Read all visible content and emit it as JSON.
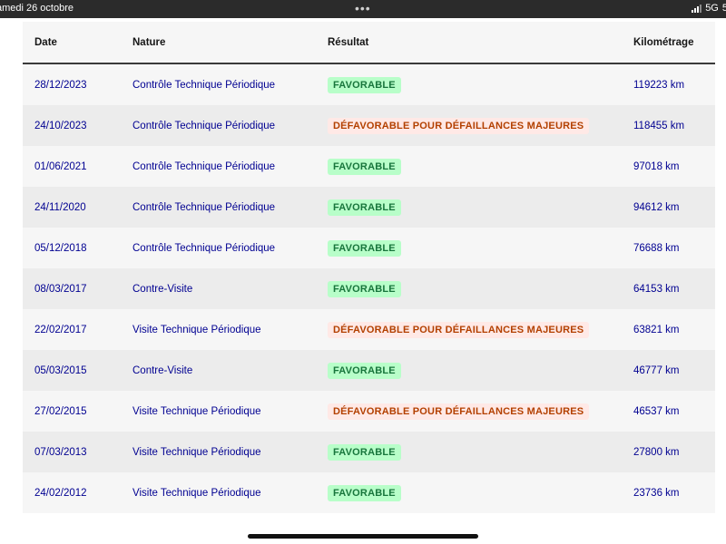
{
  "status_bar": {
    "date": "amedi 26 octobre",
    "dots": "•••",
    "network": "5G",
    "battery_fragment": "5"
  },
  "table": {
    "headers": {
      "date": "Date",
      "nature": "Nature",
      "result": "Résultat",
      "mileage": "Kilométrage"
    },
    "rows": [
      {
        "date": "28/12/2023",
        "nature": "Contrôle Technique Périodique",
        "result": "FAVORABLE",
        "status": "favorable",
        "mileage": "119223 km"
      },
      {
        "date": "24/10/2023",
        "nature": "Contrôle Technique Périodique",
        "result": "DÉFAVORABLE POUR DÉFAILLANCES MAJEURES",
        "status": "defavorable",
        "mileage": "118455 km"
      },
      {
        "date": "01/06/2021",
        "nature": "Contrôle Technique Périodique",
        "result": "FAVORABLE",
        "status": "favorable",
        "mileage": "97018 km"
      },
      {
        "date": "24/11/2020",
        "nature": "Contrôle Technique Périodique",
        "result": "FAVORABLE",
        "status": "favorable",
        "mileage": "94612 km"
      },
      {
        "date": "05/12/2018",
        "nature": "Contrôle Technique Périodique",
        "result": "FAVORABLE",
        "status": "favorable",
        "mileage": "76688 km"
      },
      {
        "date": "08/03/2017",
        "nature": "Contre-Visite",
        "result": "FAVORABLE",
        "status": "favorable",
        "mileage": "64153 km"
      },
      {
        "date": "22/02/2017",
        "nature": "Visite Technique Périodique",
        "result": "DÉFAVORABLE POUR DÉFAILLANCES MAJEURES",
        "status": "defavorable",
        "mileage": "63821 km"
      },
      {
        "date": "05/03/2015",
        "nature": "Contre-Visite",
        "result": "FAVORABLE",
        "status": "favorable",
        "mileage": "46777 km"
      },
      {
        "date": "27/02/2015",
        "nature": "Visite Technique Périodique",
        "result": "DÉFAVORABLE POUR DÉFAILLANCES MAJEURES",
        "status": "defavorable",
        "mileage": "46537 km"
      },
      {
        "date": "07/03/2013",
        "nature": "Visite Technique Périodique",
        "result": "FAVORABLE",
        "status": "favorable",
        "mileage": "27800 km"
      },
      {
        "date": "24/02/2012",
        "nature": "Visite Technique Périodique",
        "result": "FAVORABLE",
        "status": "favorable",
        "mileage": "23736 km"
      }
    ]
  },
  "colors": {
    "link_text": "#000091",
    "favorable_bg": "#b8fec9",
    "favorable_text": "#18753c",
    "defavorable_bg": "#ffe9e6",
    "defavorable_text": "#b34000",
    "row_light": "#f6f6f6",
    "row_dark": "#ececec"
  },
  "icons": {
    "signal": "cellular-signal-icon",
    "more": "more-dots-icon"
  }
}
